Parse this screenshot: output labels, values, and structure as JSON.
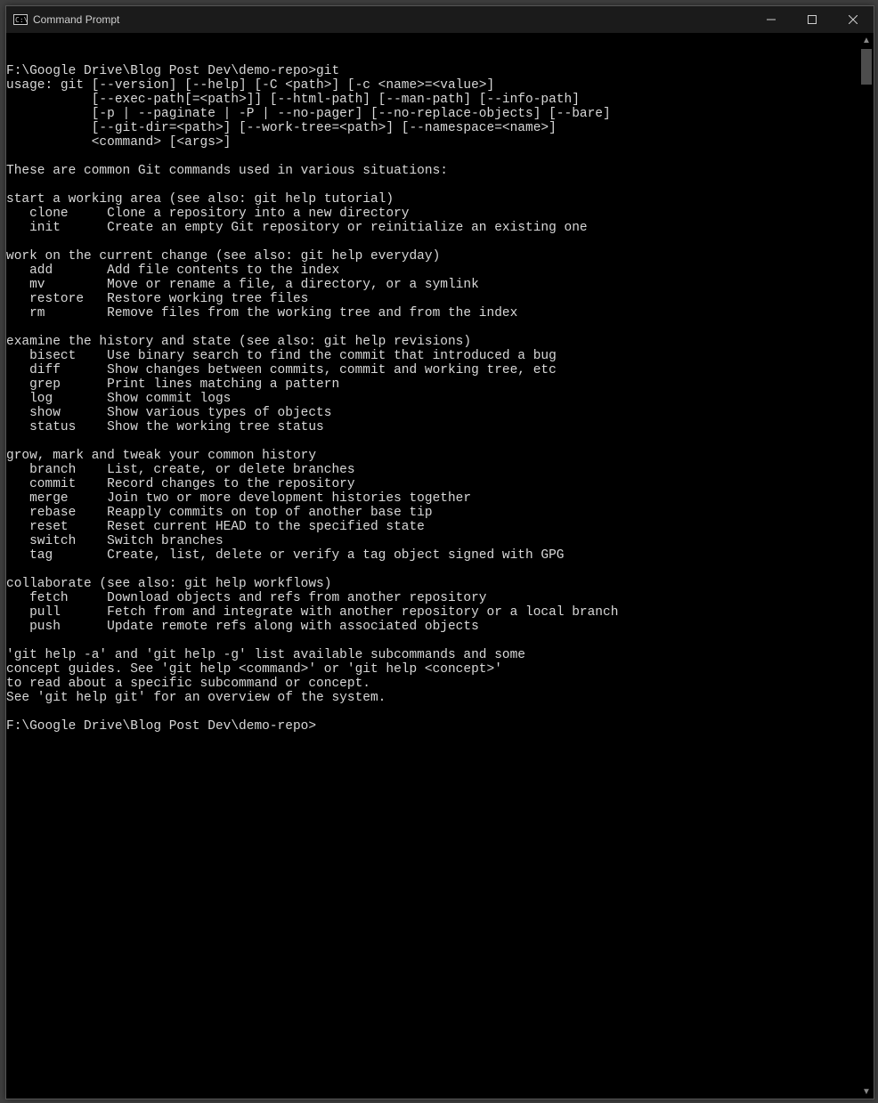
{
  "window": {
    "title": "Command Prompt"
  },
  "terminal": {
    "prompt1": "F:\\Google Drive\\Blog Post Dev\\demo-repo>git",
    "usage": [
      "usage: git [--version] [--help] [-C <path>] [-c <name>=<value>]",
      "           [--exec-path[=<path>]] [--html-path] [--man-path] [--info-path]",
      "           [-p | --paginate | -P | --no-pager] [--no-replace-objects] [--bare]",
      "           [--git-dir=<path>] [--work-tree=<path>] [--namespace=<name>]",
      "           <command> [<args>]"
    ],
    "intro": "These are common Git commands used in various situations:",
    "sections": [
      {
        "heading": "start a working area (see also: git help tutorial)",
        "items": [
          {
            "cmd": "clone",
            "desc": "Clone a repository into a new directory"
          },
          {
            "cmd": "init",
            "desc": "Create an empty Git repository or reinitialize an existing one"
          }
        ]
      },
      {
        "heading": "work on the current change (see also: git help everyday)",
        "items": [
          {
            "cmd": "add",
            "desc": "Add file contents to the index"
          },
          {
            "cmd": "mv",
            "desc": "Move or rename a file, a directory, or a symlink"
          },
          {
            "cmd": "restore",
            "desc": "Restore working tree files"
          },
          {
            "cmd": "rm",
            "desc": "Remove files from the working tree and from the index"
          }
        ]
      },
      {
        "heading": "examine the history and state (see also: git help revisions)",
        "items": [
          {
            "cmd": "bisect",
            "desc": "Use binary search to find the commit that introduced a bug"
          },
          {
            "cmd": "diff",
            "desc": "Show changes between commits, commit and working tree, etc"
          },
          {
            "cmd": "grep",
            "desc": "Print lines matching a pattern"
          },
          {
            "cmd": "log",
            "desc": "Show commit logs"
          },
          {
            "cmd": "show",
            "desc": "Show various types of objects"
          },
          {
            "cmd": "status",
            "desc": "Show the working tree status"
          }
        ]
      },
      {
        "heading": "grow, mark and tweak your common history",
        "items": [
          {
            "cmd": "branch",
            "desc": "List, create, or delete branches"
          },
          {
            "cmd": "commit",
            "desc": "Record changes to the repository"
          },
          {
            "cmd": "merge",
            "desc": "Join two or more development histories together"
          },
          {
            "cmd": "rebase",
            "desc": "Reapply commits on top of another base tip"
          },
          {
            "cmd": "reset",
            "desc": "Reset current HEAD to the specified state"
          },
          {
            "cmd": "switch",
            "desc": "Switch branches"
          },
          {
            "cmd": "tag",
            "desc": "Create, list, delete or verify a tag object signed with GPG"
          }
        ]
      },
      {
        "heading": "collaborate (see also: git help workflows)",
        "items": [
          {
            "cmd": "fetch",
            "desc": "Download objects and refs from another repository"
          },
          {
            "cmd": "pull",
            "desc": "Fetch from and integrate with another repository or a local branch"
          },
          {
            "cmd": "push",
            "desc": "Update remote refs along with associated objects"
          }
        ]
      }
    ],
    "footer": [
      "'git help -a' and 'git help -g' list available subcommands and some",
      "concept guides. See 'git help <command>' or 'git help <concept>'",
      "to read about a specific subcommand or concept.",
      "See 'git help git' for an overview of the system."
    ],
    "prompt2": "F:\\Google Drive\\Blog Post Dev\\demo-repo>"
  }
}
